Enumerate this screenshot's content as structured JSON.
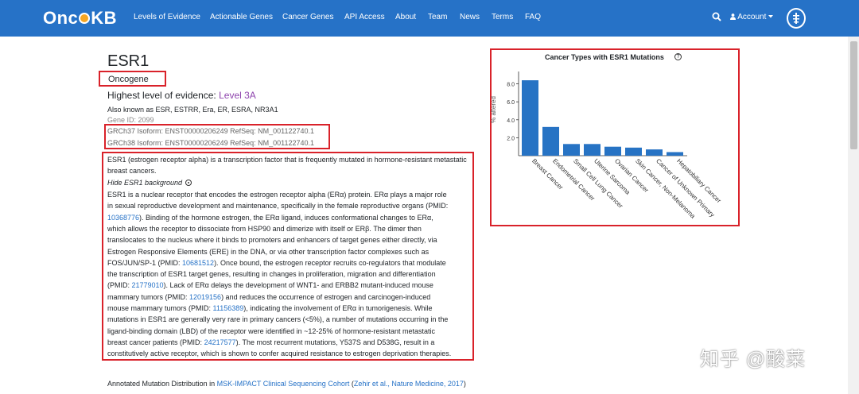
{
  "nav": {
    "logo": "OncoKB",
    "items": [
      "Levels of Evidence",
      "Actionable Genes",
      "Cancer Genes",
      "API Access",
      "About",
      "Team",
      "News",
      "Terms",
      "FAQ"
    ],
    "account": "Account"
  },
  "gene": {
    "symbol": "ESR1",
    "type": "Oncogene",
    "highest_prefix": "Highest level of evidence:",
    "highest_level": "Level 3A",
    "aliases": "Also known as ESR, ESTRR, Era, ER, ESRA, NR3A1",
    "gene_id": "Gene ID: 2099",
    "grch37": "GRCh37  Isoform: ENST00000206249 RefSeq: NM_001122740.1",
    "grch38": "GRCh38  Isoform: ENST00000206249 RefSeq: NM_001122740.1"
  },
  "summary": "ESR1 (estrogen receptor alpha) is a transcription factor that is frequently mutated in hormone-resistant metastatic breast cancers.",
  "background_toggle": "Hide ESR1 background",
  "background_lines": [
    [
      {
        "t": "ESR1 is a nuclear receptor that encodes the estrogen receptor alpha (ERα) protein. ERα plays a major role"
      }
    ],
    [
      {
        "t": "in sexual reproductive development and maintenance, specifically in the female reproductive organs (PMID:"
      }
    ],
    [
      {
        "t": "10368776",
        "link": true
      },
      {
        "t": "). Binding of the hormone estrogen, the ERα ligand, induces conformational changes to ERα,"
      }
    ],
    [
      {
        "t": "which allows the receptor to dissociate from HSP90 and dimerize with itself or ERβ. The dimer then"
      }
    ],
    [
      {
        "t": "translocates to the nucleus where it binds to promoters and enhancers of target genes either directly, via"
      }
    ],
    [
      {
        "t": "Estrogen Responsive Elements (ERE) in the DNA, or via other transcription factor complexes such as"
      }
    ],
    [
      {
        "t": "FOS/JUN/SP-1 (PMID: "
      },
      {
        "t": "10681512",
        "link": true
      },
      {
        "t": "). Once bound, the estrogen receptor recruits co-regulators that modulate"
      }
    ],
    [
      {
        "t": "the transcription of ESR1 target genes, resulting in changes in proliferation, migration and differentiation"
      }
    ],
    [
      {
        "t": "(PMID: "
      },
      {
        "t": "21779010",
        "link": true
      },
      {
        "t": "). Lack of ERα delays the development of WNT1- and ERBB2 mutant-induced mouse"
      }
    ],
    [
      {
        "t": "mammary tumors (PMID: "
      },
      {
        "t": "12019156",
        "link": true
      },
      {
        "t": ") and reduces the occurrence of estrogen and carcinogen-induced"
      }
    ],
    [
      {
        "t": "mouse mammary tumors (PMID: "
      },
      {
        "t": "11156389",
        "link": true
      },
      {
        "t": "), indicating the involvement of ERα in tumorigenesis. While"
      }
    ],
    [
      {
        "t": "mutations in ESR1 are generally very rare in primary cancers (<5%), a number of mutations occurring in the"
      }
    ],
    [
      {
        "t": "ligand-binding domain (LBD) of the receptor were identified in ~12-25% of hormone-resistant metastatic"
      }
    ],
    [
      {
        "t": "breast cancer patients (PMID: "
      },
      {
        "t": "24217577",
        "link": true
      },
      {
        "t": "). The most recurrent mutations, Y537S and D538G, result in a"
      }
    ],
    [
      {
        "t": "constitutively active receptor, which is shown to confer acquired resistance to estrogen deprivation therapies."
      }
    ]
  ],
  "annotated": {
    "prefix": "Annotated Mutation Distribution in ",
    "cohort": "MSK-IMPACT Clinical Sequencing Cohort",
    "open": " (",
    "ref": "Zehir et al., Nature Medicine, 2017",
    "close": ")"
  },
  "chart_data": {
    "type": "bar",
    "title": "Cancer Types with ESR1 Mutations",
    "ylabel": "% altered",
    "categories": [
      "Breast Cancer",
      "Endometrial Cancer",
      "Small Cell Lung Cancer",
      "Uterine Sarcoma",
      "Ovarian Cancer",
      "Skin Cancer, Non-Melanoma",
      "Cancer of Unknown Primary",
      "Hepatobiliary Cancer"
    ],
    "values": [
      8.4,
      3.2,
      1.3,
      1.3,
      1.0,
      0.9,
      0.7,
      0.4
    ],
    "yticks": [
      2.0,
      4.0,
      6.0,
      8.0
    ],
    "tick_labels": [
      "2.0",
      "4.0",
      "6.0",
      "8.0"
    ],
    "ylim": [
      0,
      9.2
    ],
    "color": "#2773c4"
  },
  "watermark": "知乎 @酸菜",
  "colors": {
    "nav": "#2672c7",
    "highlight": "#d9222a",
    "link": "#2672c7",
    "level": "#8e44ad"
  }
}
